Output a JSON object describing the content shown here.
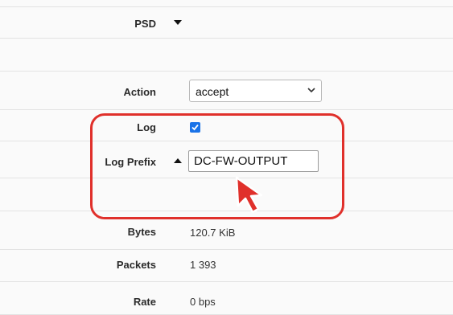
{
  "fields": {
    "psd": {
      "label": "PSD"
    },
    "action": {
      "label": "Action",
      "selected": "accept"
    },
    "log": {
      "label": "Log",
      "checked": true
    },
    "log_prefix": {
      "label": "Log Prefix",
      "value": "DC-FW-OUTPUT"
    },
    "bytes": {
      "label": "Bytes",
      "value": "120.7 KiB"
    },
    "packets": {
      "label": "Packets",
      "value": "1 393"
    },
    "rate": {
      "label": "Rate",
      "value": "0 bps"
    }
  },
  "colors": {
    "highlight": "#e0302b",
    "checkbox": "#1a73e8"
  },
  "icons": {
    "psd_toggle": "caret-down-icon",
    "log_prefix_toggle": "caret-up-icon",
    "select_arrow": "chevron-down-icon",
    "cursor": "mouse-pointer-icon"
  }
}
